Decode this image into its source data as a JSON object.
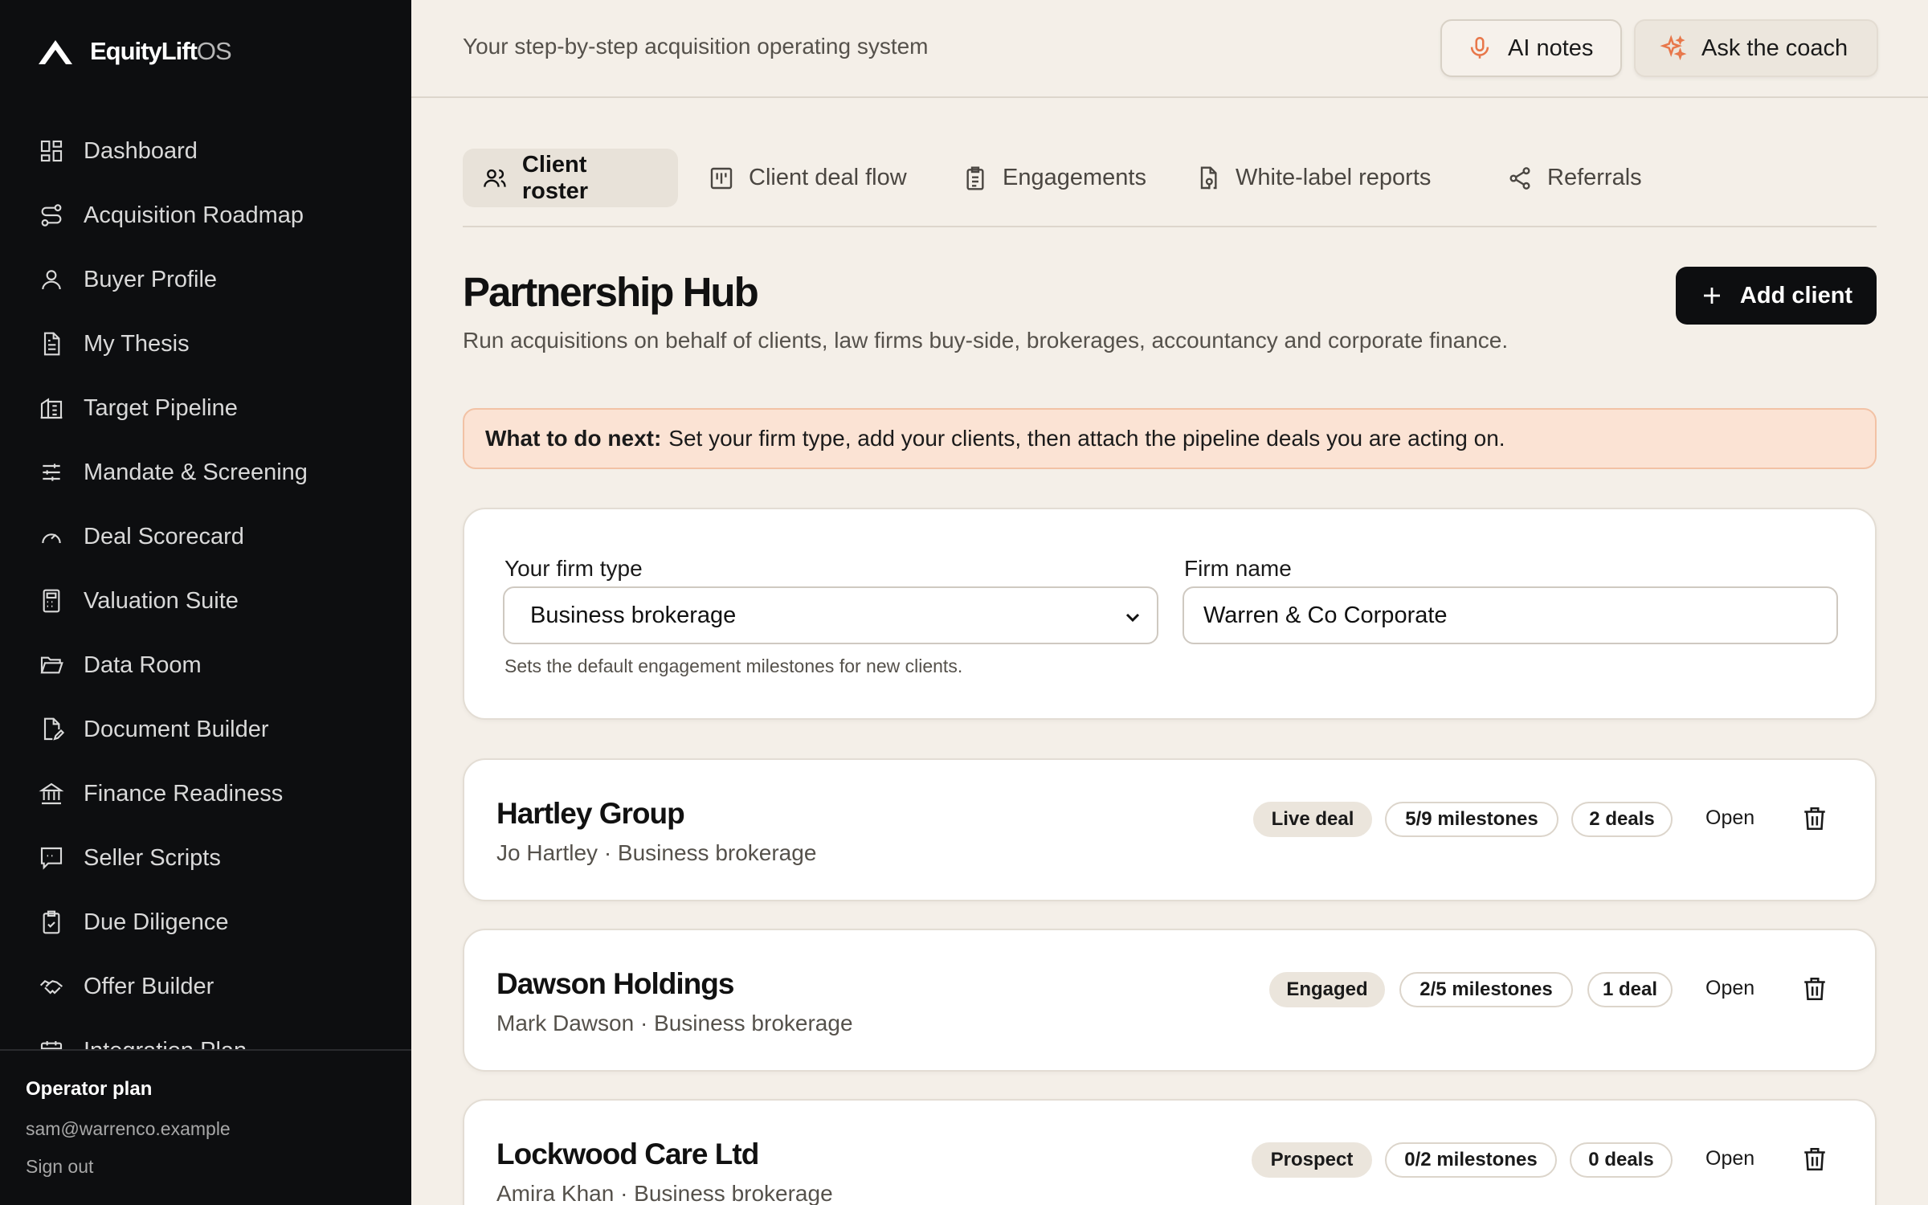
{
  "brand": {
    "name": "EquityLift",
    "suffix": "OS"
  },
  "sidebar": {
    "items": [
      {
        "label": "Dashboard",
        "icon": "dashboard-icon"
      },
      {
        "label": "Acquisition Roadmap",
        "icon": "route-icon"
      },
      {
        "label": "Buyer Profile",
        "icon": "user-icon"
      },
      {
        "label": "My Thesis",
        "icon": "document-icon"
      },
      {
        "label": "Target Pipeline",
        "icon": "building-icon"
      },
      {
        "label": "Mandate & Screening",
        "icon": "sliders-icon"
      },
      {
        "label": "Deal Scorecard",
        "icon": "gauge-icon"
      },
      {
        "label": "Valuation Suite",
        "icon": "calculator-icon"
      },
      {
        "label": "Data Room",
        "icon": "folder-icon"
      },
      {
        "label": "Document Builder",
        "icon": "file-edit-icon"
      },
      {
        "label": "Finance Readiness",
        "icon": "bank-icon"
      },
      {
        "label": "Seller Scripts",
        "icon": "chat-square-icon"
      },
      {
        "label": "Due Diligence",
        "icon": "clipboard-check-icon"
      },
      {
        "label": "Offer Builder",
        "icon": "handshake-icon"
      },
      {
        "label": "Integration Plan",
        "icon": "calendar-icon"
      }
    ],
    "footer": {
      "plan": "Operator plan",
      "email": "sam@warrenco.example",
      "sign_out": "Sign out"
    }
  },
  "topbar": {
    "tagline": "Your step-by-step acquisition operating system",
    "ai_notes": "AI notes",
    "ask_coach": "Ask the coach"
  },
  "tabs": [
    {
      "label": "Client roster",
      "icon": "users-icon",
      "active": true
    },
    {
      "label": "Client deal flow",
      "icon": "kanban-icon",
      "active": false
    },
    {
      "label": "Engagements",
      "icon": "clipboard-icon",
      "active": false
    },
    {
      "label": "White-label reports",
      "icon": "file-report-icon",
      "active": false
    },
    {
      "label": "Referrals",
      "icon": "share-icon",
      "active": false
    }
  ],
  "page": {
    "title": "Partnership Hub",
    "description": "Run acquisitions on behalf of clients, law firms buy-side, brokerages, accountancy and corporate finance.",
    "add_client": "Add client",
    "next_step_label": "What to do next:",
    "next_step_text": "Set your firm type, add your clients, then attach the pipeline deals you are acting on."
  },
  "firm": {
    "type_label": "Your firm type",
    "type_value": "Business brokerage",
    "name_label": "Firm name",
    "name_value": "Warren & Co Corporate",
    "help": "Sets the default engagement milestones for new clients."
  },
  "clients": [
    {
      "name": "Hartley Group",
      "contact": "Jo Hartley · Business brokerage",
      "status": "Live deal",
      "milestones": "5/9 milestones",
      "deals": "2 deals",
      "open": "Open"
    },
    {
      "name": "Dawson Holdings",
      "contact": "Mark Dawson · Business brokerage",
      "status": "Engaged",
      "milestones": "2/5 milestones",
      "deals": "1 deal",
      "open": "Open"
    },
    {
      "name": "Lockwood Care Ltd",
      "contact": "Amira Khan · Business brokerage",
      "status": "Prospect",
      "milestones": "0/2 milestones",
      "deals": "0 deals",
      "open": "Open"
    }
  ],
  "colors": {
    "sidebar_bg": "#0d0e10",
    "page_bg": "#f4efe8",
    "accent_orange": "#e8774a",
    "banner_bg": "#fbe3d4"
  }
}
